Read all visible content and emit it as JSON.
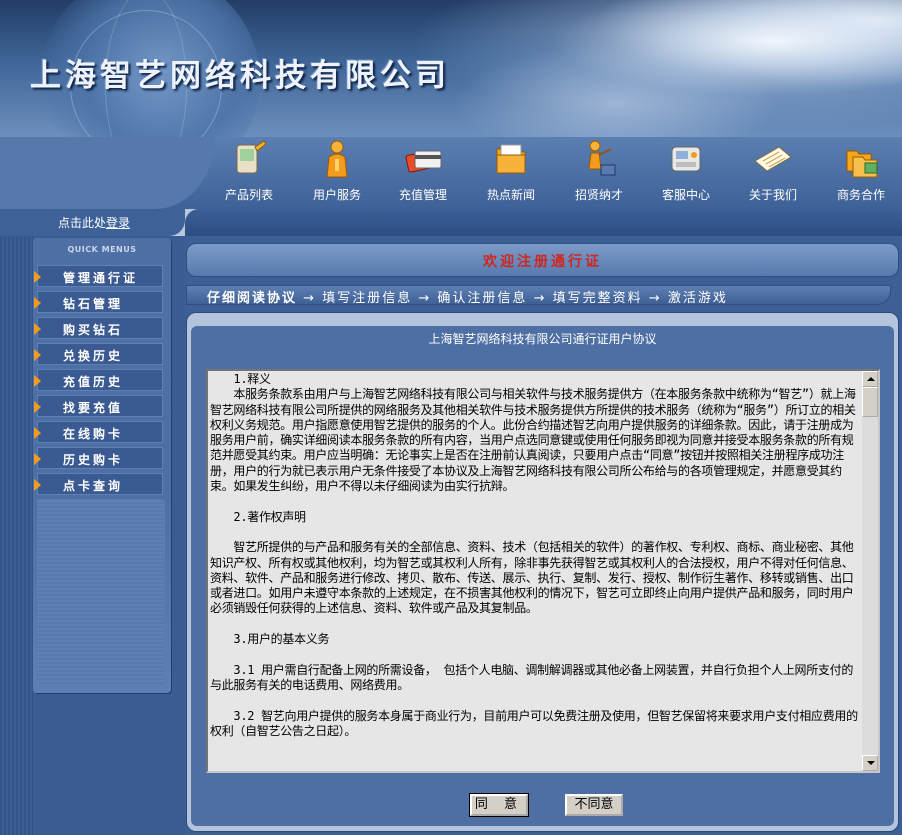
{
  "header": {
    "company_name": "上海智艺网络科技有限公司"
  },
  "nav": [
    {
      "label": "产品列表",
      "icon": "pda-icon"
    },
    {
      "label": "用户服务",
      "icon": "person-icon"
    },
    {
      "label": "充值管理",
      "icon": "card-icon"
    },
    {
      "label": "热点新闻",
      "icon": "folder-icon"
    },
    {
      "label": "招贤纳才",
      "icon": "recruit-figure-icon"
    },
    {
      "label": "客服中心",
      "icon": "phone-icon"
    },
    {
      "label": "关于我们",
      "icon": "document-icon"
    },
    {
      "label": "商务合作",
      "icon": "folders-icon"
    }
  ],
  "login": {
    "prefix": "点击此处",
    "link": "登录"
  },
  "sidebar": {
    "title": "QUICK MENUS",
    "items": [
      {
        "label": "管理通行证"
      },
      {
        "label": "钻石管理"
      },
      {
        "label": "购买钻石"
      },
      {
        "label": "兑换历史"
      },
      {
        "label": "充值历史"
      },
      {
        "label": "找要充值"
      },
      {
        "label": "在线购卡"
      },
      {
        "label": "历史购卡"
      },
      {
        "label": "点卡查询"
      }
    ]
  },
  "main": {
    "welcome": "欢迎注册通行证",
    "steps": [
      "仔细阅读协议",
      "填写注册信息",
      "确认注册信息",
      "填写完整资料",
      "激活游戏"
    ],
    "step_arrow": "→",
    "agreement_title": "上海智艺网络科技有限公司通行证用户协议",
    "agreement_text": "　　1.释义\n　　本服务条款系由用户与上海智艺网络科技有限公司与相关软件与技术服务提供方（在本服务条款中统称为“智艺”）就上海智艺网络科技有限公司所提供的网络服务及其他相关软件与技术服务提供方所提供的技术服务（统称为“服务”）所订立的相关权利义务规范。用户指愿意使用智艺提供的服务的个人。此份合约描述智艺向用户提供服务的详细条款。因此，请于注册成为服务用户前，确实详细阅读本服务条款的所有内容，当用户点选同意键或使用任何服务即视为同意并接受本服务条款的所有规范并愿受其约束。用户应当明确：无论事实上是否在注册前认真阅读，只要用户点击“同意”按钮并按照相关注册程序成功注册，用户的行为就已表示用户无条件接受了本协议及上海智艺网络科技有限公司所公布给与的各项管理规定，并愿意受其约束。如果发生纠纷，用户不得以未仔细阅读为由实行抗辩。\n\n　　2.著作权声明\n\n　　智艺所提供的与产品和服务有关的全部信息、资料、技术（包括相关的软件）的著作权、专利权、商标、商业秘密、其他知识产权、所有权或其他权利，均为智艺或其权利人所有，除非事先获得智艺或其权利人的合法授权，用户不得对任何信息、资料、软件、产品和服务进行修改、拷贝、散布、传送、展示、执行、复制、发行、授权、制作衍生著作、移转或销售、出口或者进口。如用户未遵守本条款的上述规定，在不损害其他权利的情况下，智艺可立即终止向用户提供产品和服务，同时用户必须销毁任何获得的上述信息、资料、软件或产品及其复制品。\n\n　　3.用户的基本义务\n\n　　3.1 用户需自行配备上网的所需设备， 包括个人电脑、调制解调器或其他必备上网装置，并自行负担个人上网所支付的与此服务有关的电话费用、网络费用。\n\n　　3.2 智艺向用户提供的服务本身属于商业行为，目前用户可以免费注册及使用，但智艺保留将来要求用户支付相应费用的权利（自智艺公告之日起）。",
    "agree_button": "同 意",
    "disagree_button": "不同意"
  },
  "colors": {
    "accent": "#f29b1c",
    "welcome_text": "#d0261e",
    "nav_bg": "#3e6298"
  }
}
